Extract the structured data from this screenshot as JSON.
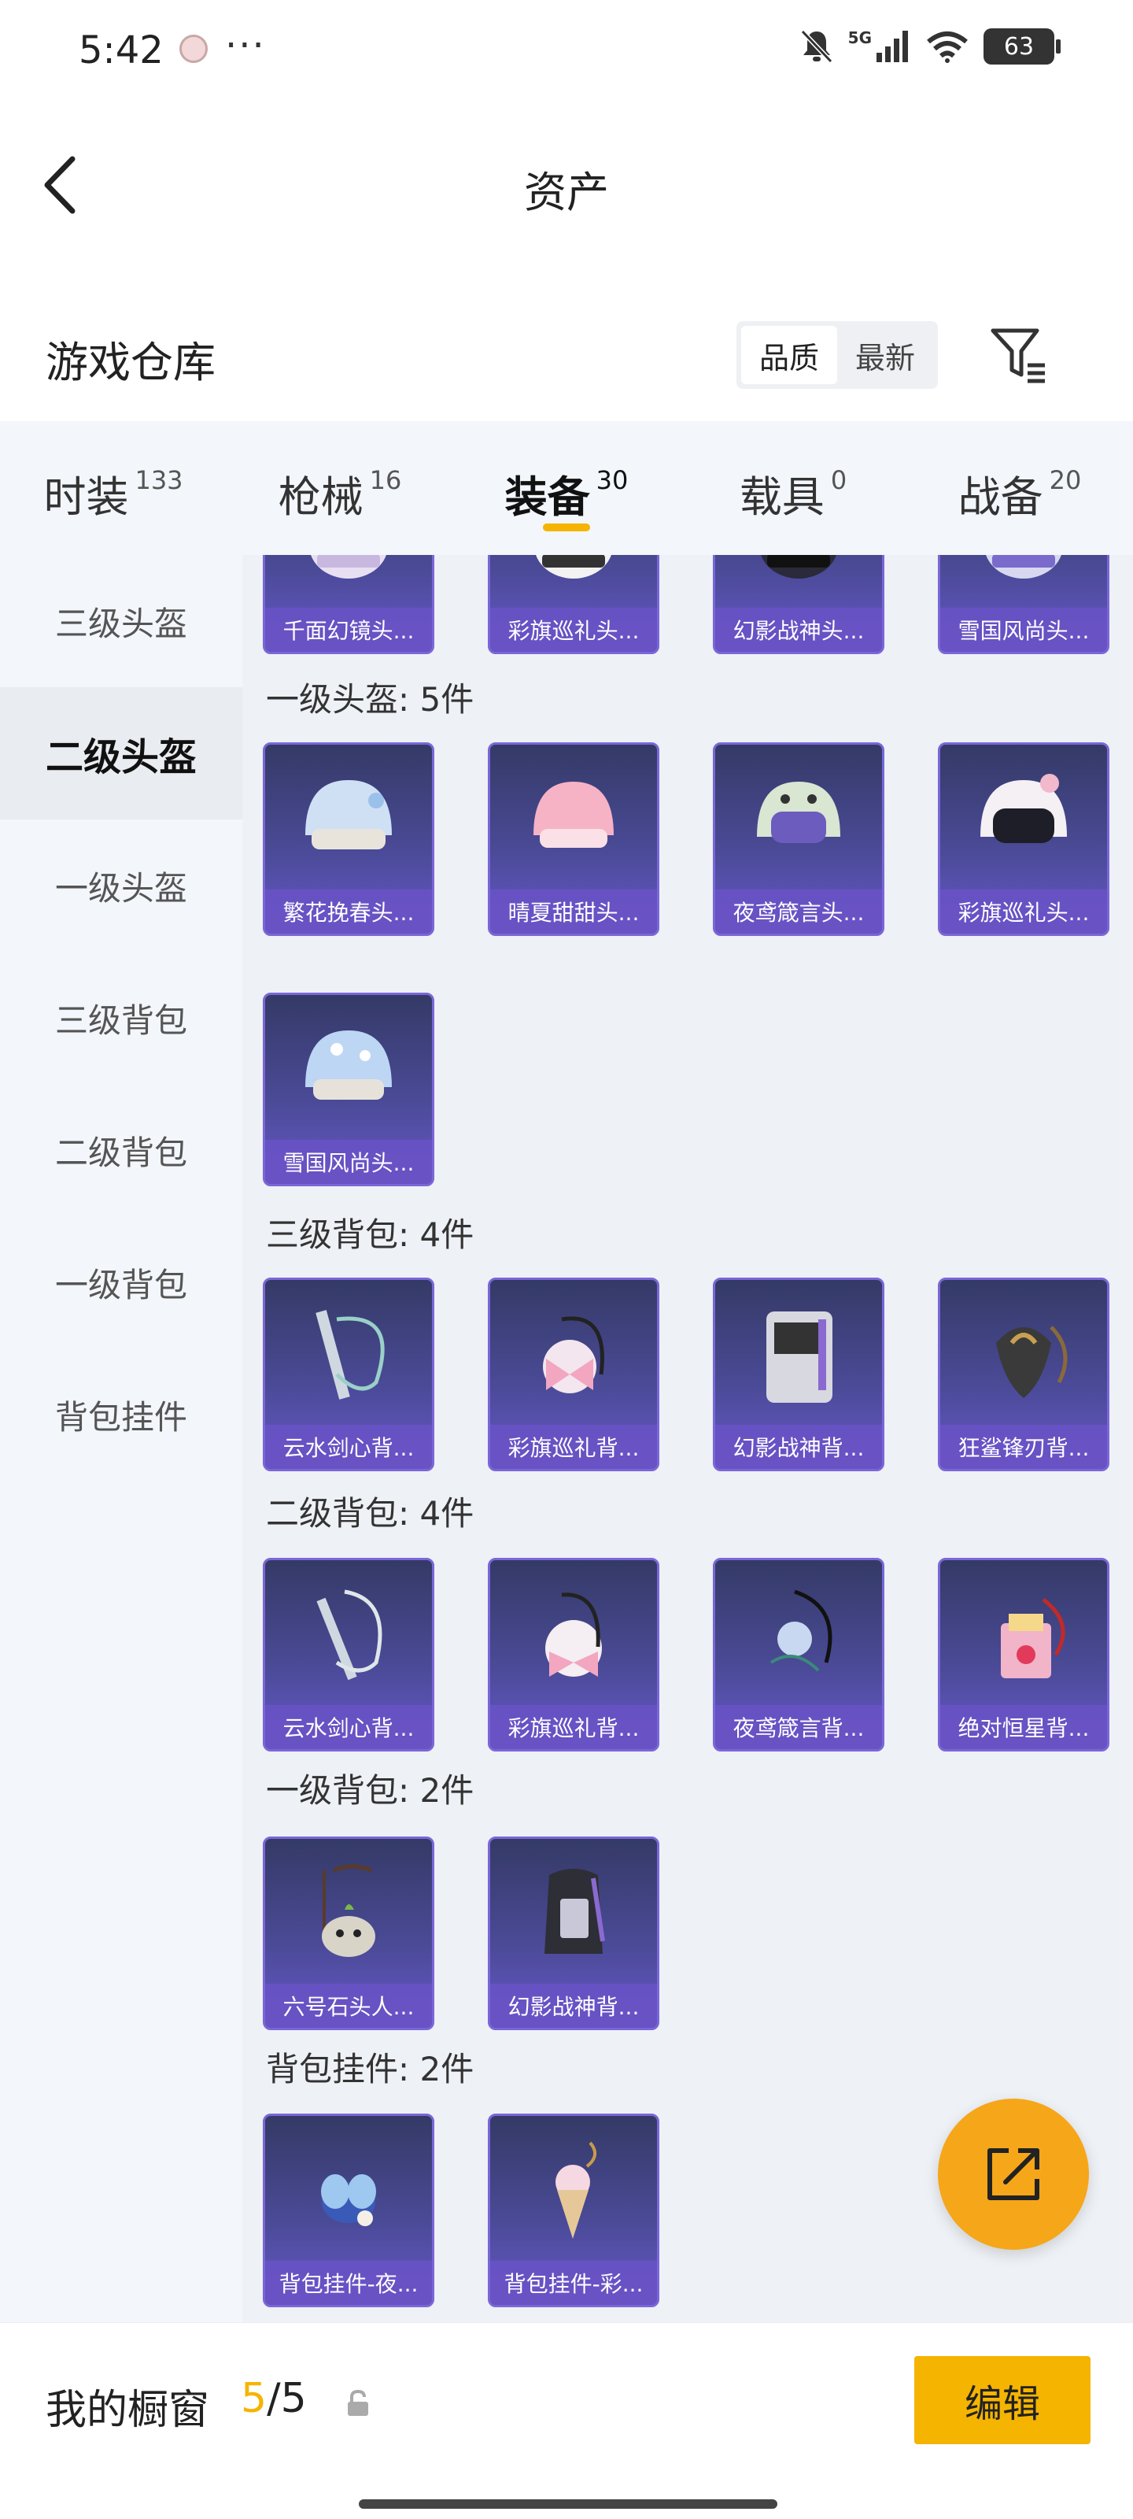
{
  "status": {
    "time": "5:42",
    "more": "···",
    "network": "5G",
    "battery": "63"
  },
  "header": {
    "title": "资产"
  },
  "section": {
    "title": "游戏仓库",
    "sort_options": [
      "品质",
      "最新"
    ],
    "sort_active": "品质"
  },
  "tabs": [
    {
      "label": "时装",
      "count": "133"
    },
    {
      "label": "枪械",
      "count": "16"
    },
    {
      "label": "装备",
      "count": "30",
      "active": true
    },
    {
      "label": "载具",
      "count": "0"
    },
    {
      "label": "战备",
      "count": "20"
    }
  ],
  "sidebar": [
    {
      "label": "三级头盔"
    },
    {
      "label": "二级头盔",
      "active": true
    },
    {
      "label": "一级头盔"
    },
    {
      "label": "三级背包"
    },
    {
      "label": "二级背包"
    },
    {
      "label": "一级背包"
    },
    {
      "label": "背包挂件"
    }
  ],
  "groups": [
    {
      "header": "",
      "items": [
        "千面幻镜头...",
        "彩旗巡礼头...",
        "幻影战神头...",
        "雪国风尚头..."
      ]
    },
    {
      "header": "一级头盔: 5件",
      "items": [
        "繁花挽春头...",
        "晴夏甜甜头...",
        "夜鸢箴言头...",
        "彩旗巡礼头...",
        "雪国风尚头..."
      ]
    },
    {
      "header": "三级背包: 4件",
      "items": [
        "云水剑心背...",
        "彩旗巡礼背...",
        "幻影战神背...",
        "狂鲨锋刃背..."
      ]
    },
    {
      "header": "二级背包: 4件",
      "items": [
        "云水剑心背...",
        "彩旗巡礼背...",
        "夜鸢箴言背...",
        "绝对恒星背..."
      ]
    },
    {
      "header": "一级背包: 2件",
      "items": [
        "六号石头人...",
        "幻影战神背..."
      ]
    },
    {
      "header": "背包挂件: 2件",
      "items": [
        "背包挂件-夜...",
        "背包挂件-彩..."
      ]
    }
  ],
  "bottom": {
    "showcase_label": "我的橱窗",
    "count_current": "5",
    "count_sep": "/",
    "count_total": "5",
    "edit_label": "编辑"
  }
}
